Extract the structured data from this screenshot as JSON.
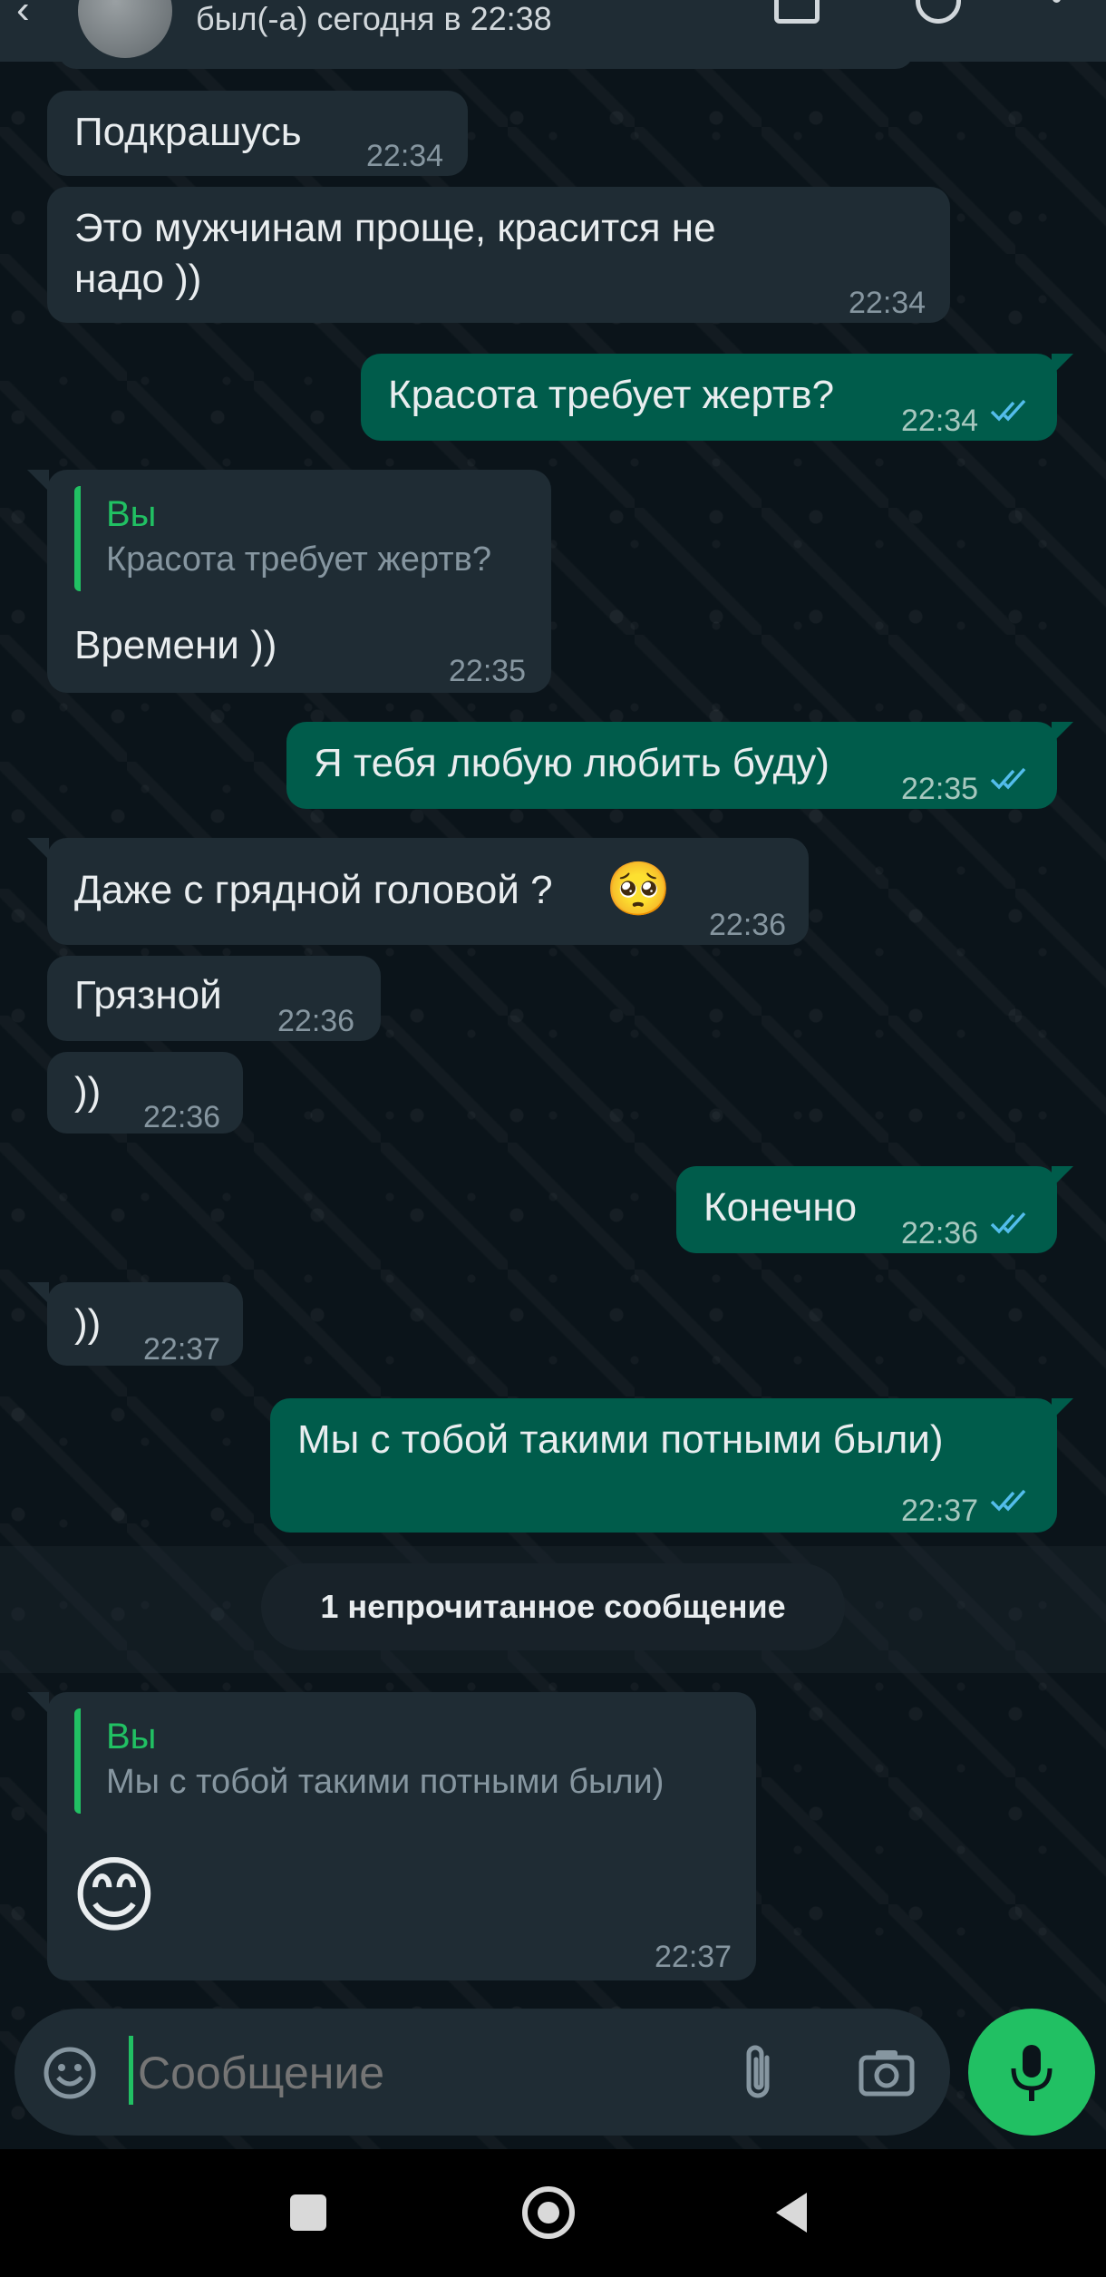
{
  "header": {
    "status": "был(-а) сегодня в 22:38",
    "icons": [
      "back-arrow-icon",
      "video-call-icon",
      "phone-icon",
      "more-options-icon"
    ]
  },
  "messages": [
    {
      "dir": "in",
      "text": "Подкрашусь",
      "time": "22:34"
    },
    {
      "dir": "in",
      "text_line1": "Это мужчинам проще, красится не",
      "text_line2": "надо ))",
      "time": "22:34"
    },
    {
      "dir": "out",
      "text": "Красота требует жертв?",
      "time": "22:34"
    },
    {
      "dir": "in",
      "reply_author": "Вы",
      "reply_text": "Красота требует жертв?",
      "text": "Времени ))",
      "time": "22:35"
    },
    {
      "dir": "out",
      "text": "Я тебя любую любить буду)",
      "time": "22:35"
    },
    {
      "dir": "in",
      "text": "Даже с грядной головой ?",
      "emoji": "🥺",
      "time": "22:36"
    },
    {
      "dir": "in",
      "text": "Грязной",
      "time": "22:36"
    },
    {
      "dir": "in",
      "text": "))",
      "time": "22:36"
    },
    {
      "dir": "out",
      "text": "Конечно",
      "time": "22:36"
    },
    {
      "dir": "in",
      "text": "))",
      "time": "22:37"
    },
    {
      "dir": "out",
      "text": "Мы с тобой такими потными были)",
      "time": "22:37"
    },
    {
      "dir": "in",
      "reply_author": "Вы",
      "reply_text": "Мы с тобой такими потными были)",
      "emoji": "😊",
      "time": "22:37"
    }
  ],
  "unread_banner": "1 непрочитанное сообщение",
  "composer": {
    "placeholder": "Сообщение",
    "icons": [
      "emoji-icon",
      "attach-icon",
      "camera-icon",
      "mic-icon"
    ]
  },
  "colors": {
    "background": "#0b141a",
    "incoming_bubble": "#1f2c34",
    "outgoing_bubble": "#005c4b",
    "accent": "#21c063",
    "read_ticks": "#53bdeb"
  },
  "system_nav": [
    "recents-icon",
    "home-icon",
    "back-icon"
  ]
}
